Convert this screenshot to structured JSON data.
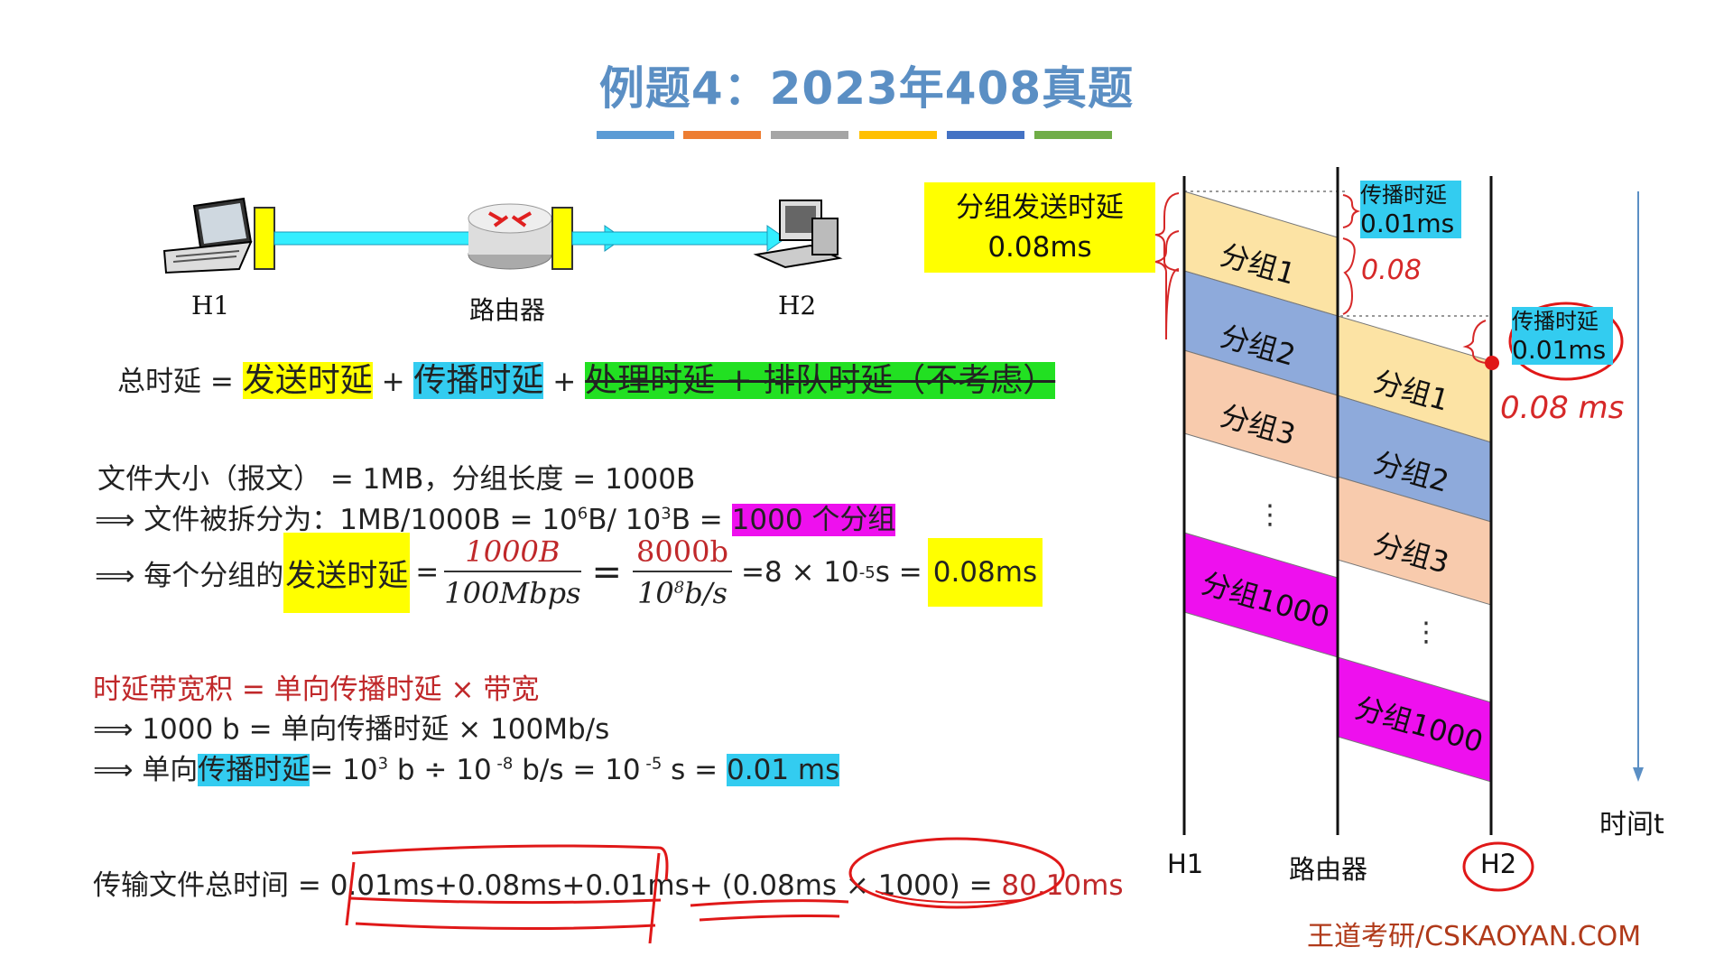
{
  "title": "例题4：2023年408真题",
  "colors": {
    "accent_bars": [
      "#5b9bd5",
      "#ed7d31",
      "#a5a5a5",
      "#ffc000",
      "#4472c4",
      "#70ad47"
    ],
    "yellow": "#ffff00",
    "cyan": "#33ccf0",
    "green": "#22e022",
    "magenta": "#ee10ee",
    "red": "#c0282a"
  },
  "network": {
    "h1": "H1",
    "router": "路由器",
    "h2": "H2"
  },
  "total_delay": {
    "lhs": "总时延 =",
    "send": "发送时延",
    "plus1": "+",
    "prop": "传播时延",
    "plus2": "+",
    "ignored": "处理时延 + 排队时延（不考虑）"
  },
  "split": {
    "line1": "文件大小（报文） = 1MB，分组长度 = 1000B",
    "line2_prefix": "⟹ 文件被拆分为：1MB/1000B = 10",
    "line2_exp1": "6",
    "line2_mid": "B/ 10",
    "line2_exp2": "3",
    "line2_suffix": "B =",
    "line2_hl": "1000 个分组"
  },
  "send_calc": {
    "prefix": "⟹ 每个分组的",
    "hl": "发送时延",
    "eq1": "=",
    "frac1_num": "1000B",
    "frac1_den": "100Mbps",
    "eq2": "=",
    "frac2_num": "8000b",
    "frac2_den_a": "10",
    "frac2_den_exp": "8",
    "frac2_den_b": "b/s",
    "eq3": "=8 × 10",
    "exp": "-5",
    "unit": " s =",
    "result": "0.08ms"
  },
  "bdp": {
    "line1": "时延带宽积 = 单向传播时延 × 带宽",
    "line2": "⟹ 1000 b = 单向传播时延 × 100Mb/s",
    "line3_prefix": "⟹ 单向",
    "line3_hl": "传播时延",
    "line3_a": "= 10",
    "line3_exp1": "3",
    "line3_b": " b  ÷ 10",
    "line3_exp2": " -8",
    "line3_c": " b/s = 10",
    "line3_exp3": " -5",
    "line3_d": " s =",
    "line3_result": "0.01 ms"
  },
  "total_time": {
    "label": "传输文件总时间 =",
    "expr": "0.01ms+0.08ms+0.01ms+ (0.08ms × 1000) =",
    "result": "80.10ms"
  },
  "diagram": {
    "send_delay_label": "分组发送时延",
    "send_delay_value": "0.08ms",
    "prop_label_1": "传播时延",
    "prop_value_1": "0.01ms",
    "prop_label_2": "传播时延",
    "prop_value_2": "0.01ms",
    "hand_008": "0.08",
    "hand_008ms": "0.08 ms",
    "h1_packets": [
      "分组1",
      "分组2",
      "分组3",
      "⋮",
      "分组1000"
    ],
    "r_packets": [
      "分组1",
      "分组2",
      "分组3",
      "⋮",
      "分组1000"
    ],
    "axis_h1": "H1",
    "axis_router": "路由器",
    "axis_h2": "H2",
    "time_label": "时间t"
  },
  "watermark": "王道考研/CSKAOYAN.COM"
}
